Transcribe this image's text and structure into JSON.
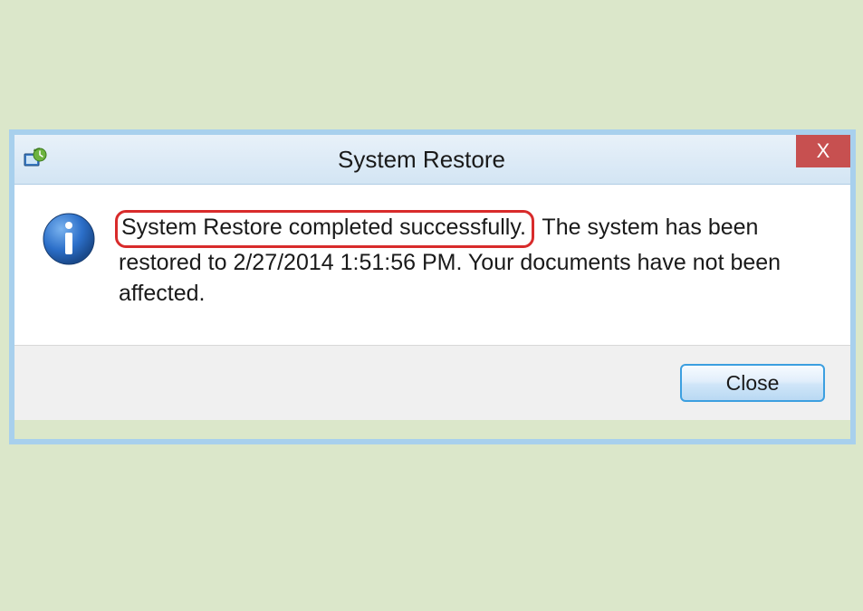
{
  "dialog": {
    "title": "System Restore",
    "message_highlighted": "System Restore completed successfully.",
    "message_rest": " The system has been restored to 2/27/2014 1:51:56 PM. Your documents have not been affected.",
    "close_x": "X",
    "close_button": "Close"
  }
}
